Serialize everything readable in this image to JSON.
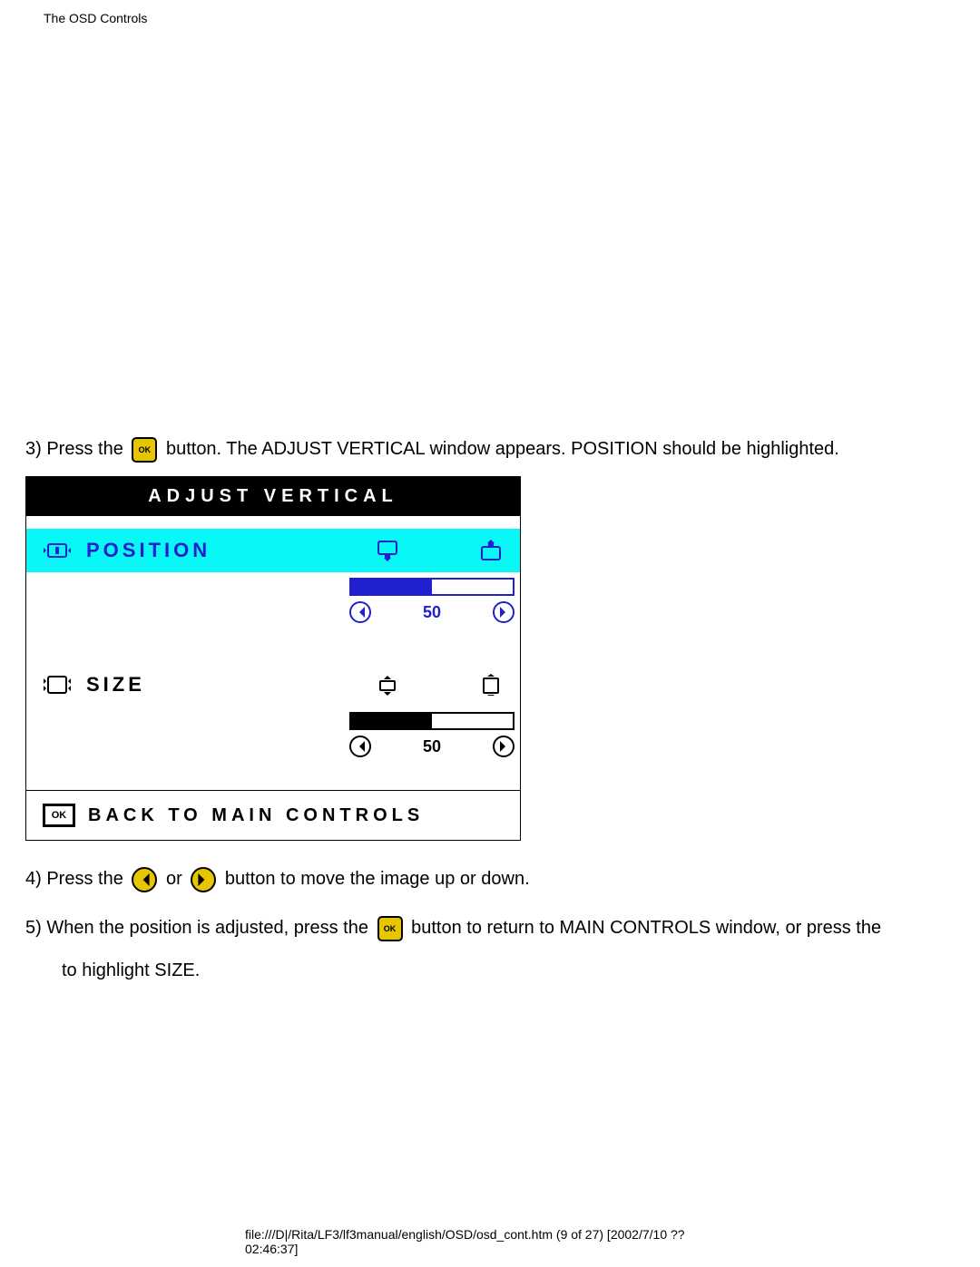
{
  "header": "The OSD Controls",
  "step3_a": "3) Press the ",
  "step3_b": " button. The ADJUST VERTICAL window appears. POSITION should be highlighted.",
  "osd": {
    "title": "ADJUST VERTICAL",
    "position_label": "POSITION",
    "position_value": "50",
    "size_label": "SIZE",
    "size_value": "50",
    "back_label": "BACK TO MAIN CONTROLS"
  },
  "step4_a": "4) Press the ",
  "step4_b": " or ",
  "step4_c": " button to move the image up or down.",
  "step5_a": "5) When the position is adjusted, press the ",
  "step5_b": " button to return to MAIN CONTROLS window, or press the",
  "step5_c": "to highlight SIZE.",
  "footer": "file:///D|/Rita/LF3/lf3manual/english/OSD/osd_cont.htm (9 of 27) [2002/7/10 ?? 02:46:37]"
}
